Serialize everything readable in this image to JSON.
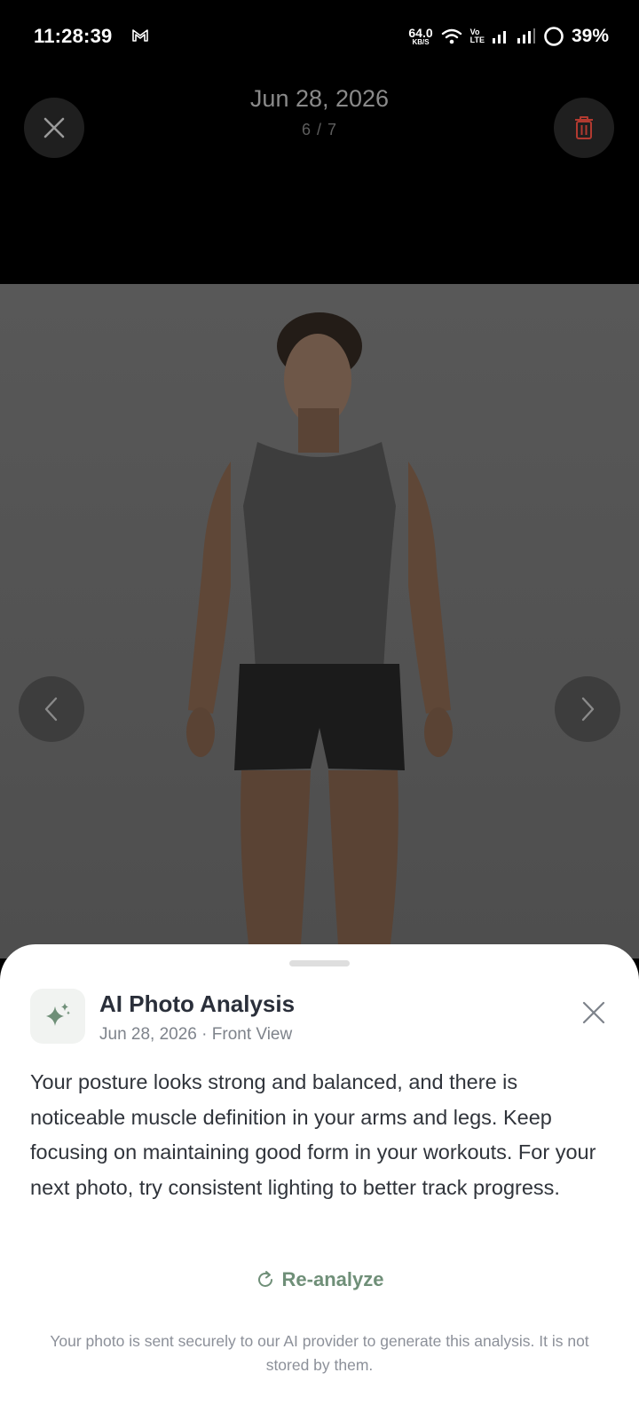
{
  "status_bar": {
    "time": "11:28:39",
    "net_speed_value": "64.0",
    "net_speed_unit": "KB/S",
    "volte_line1": "Vo",
    "volte_line2": "LTE",
    "battery": "39%",
    "icons": [
      "gmail-icon",
      "wifi-icon",
      "signal-icon",
      "battery-icon"
    ]
  },
  "viewer": {
    "date": "Jun 28, 2026",
    "counter": "6 / 7",
    "photo_current": 6,
    "photo_total": 7,
    "icons": [
      "close-icon",
      "trash-icon",
      "chevron-left-icon",
      "chevron-right-icon"
    ]
  },
  "analysis": {
    "title": "AI Photo Analysis",
    "subtitle": "Jun 28, 2026 · Front View",
    "body": "Your posture looks strong and balanced, and there is noticeable muscle definition in your arms and legs. Keep focusing on maintaining good form in your workouts. For your next photo, try consistent lighting to better track progress.",
    "reanalyze_label": "Re-analyze",
    "disclaimer": "Your photo is sent securely to our AI provider to generate this analysis. It is not stored by them."
  },
  "colors": {
    "accent_green": "#6f8f78",
    "delete_red": "#b23a30",
    "photo_backdrop": "#545454"
  }
}
